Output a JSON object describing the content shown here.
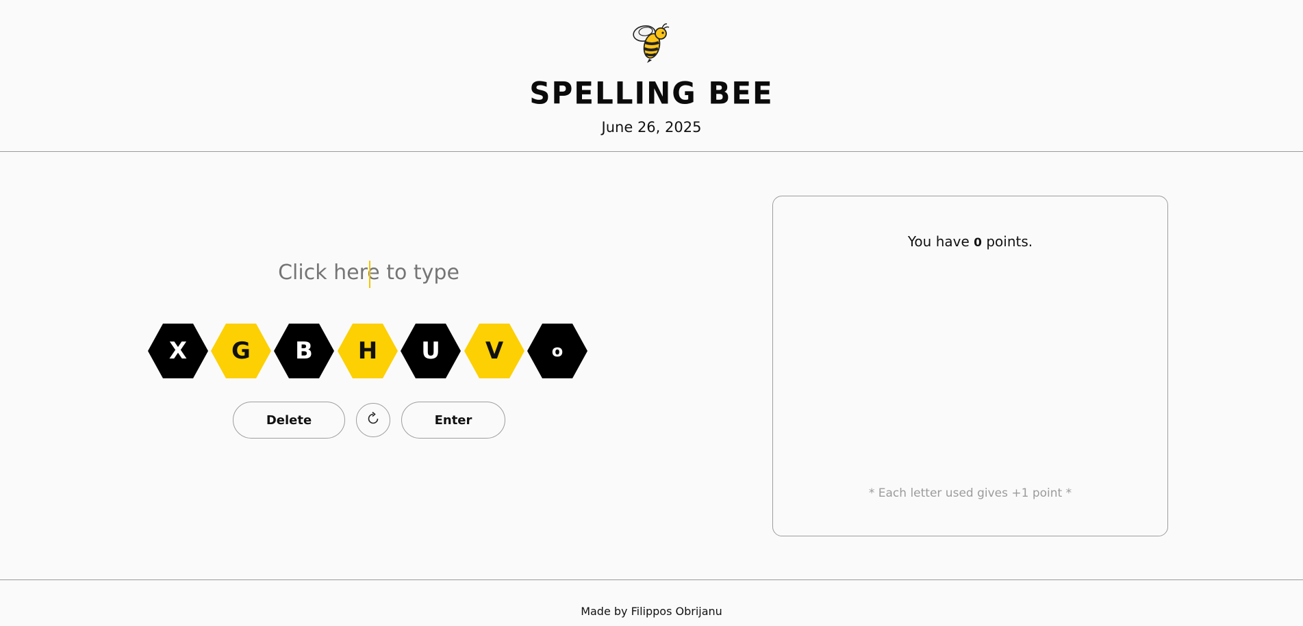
{
  "header": {
    "logo_icon": "bee-icon",
    "title": "SPELLING BEE",
    "date": "June 26, 2025"
  },
  "game": {
    "input_placeholder": "Click here to type",
    "letters": [
      {
        "letter": "X",
        "color": "#000000"
      },
      {
        "letter": "G",
        "color": "#fcd002"
      },
      {
        "letter": "B",
        "color": "#000000"
      },
      {
        "letter": "H",
        "color": "#fcd002"
      },
      {
        "letter": "U",
        "color": "#000000"
      },
      {
        "letter": "V",
        "color": "#fcd002"
      },
      {
        "letter": "o",
        "color": "#000000"
      }
    ],
    "delete_label": "Delete",
    "shuffle_icon": "refresh-icon",
    "enter_label": "Enter"
  },
  "score": {
    "prefix": "You have",
    "points": "0",
    "suffix": "points.",
    "note": "* Each letter used gives +1 point *"
  },
  "footer": {
    "credit": "Made by Filippos Obrijanu"
  },
  "colors": {
    "accent": "#fcd002",
    "dark": "#000000",
    "background": "#fafafa"
  }
}
